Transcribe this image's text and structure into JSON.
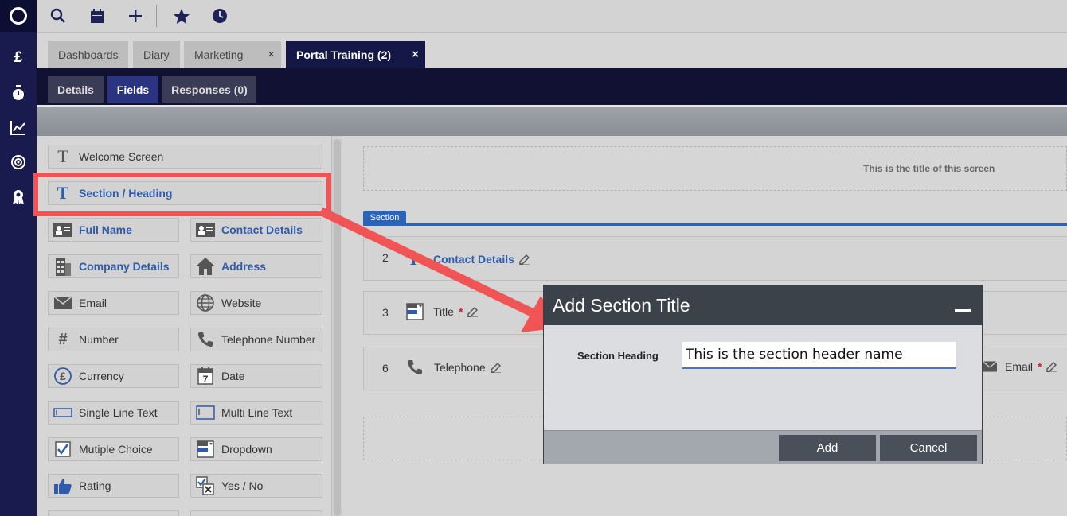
{
  "tabs": [
    {
      "label": "Dashboards"
    },
    {
      "label": "Diary"
    },
    {
      "label": "Marketing",
      "close": "×"
    },
    {
      "label": "Portal Training (2)",
      "close": "×"
    }
  ],
  "subtabs": [
    {
      "label": "Details"
    },
    {
      "label": "Fields"
    },
    {
      "label": "Responses (0)"
    }
  ],
  "palette": {
    "welcome": "Welcome Screen",
    "section_heading": "Section / Heading",
    "full_name": "Full Name",
    "contact_details": "Contact Details",
    "company_details": "Company Details",
    "address": "Address",
    "email": "Email",
    "website": "Website",
    "number": "Number",
    "telephone_number": "Telephone Number",
    "currency": "Currency",
    "date": "Date",
    "date_day": "7",
    "single_line_text": "Single Line Text",
    "multi_line_text": "Multi Line Text",
    "multiple_choice": "Mutiple Choice",
    "dropdown": "Dropdown",
    "rating": "Rating",
    "yes_no": "Yes / No"
  },
  "canvas": {
    "screen_title": "This is the title of this screen",
    "section_tag": "Section",
    "rows": [
      {
        "num": "2",
        "label": "Contact Details"
      },
      {
        "num": "3",
        "label": "Title",
        "required": "*"
      },
      {
        "num": "6",
        "label": "Telephone",
        "right_label": "Email",
        "right_required": "*"
      }
    ]
  },
  "modal": {
    "title": "Add Section Title",
    "field_label": "Section Heading",
    "field_value": "This is the section header name",
    "add": "Add",
    "cancel": "Cancel"
  },
  "colors": {
    "rail": "#191b4f",
    "accent_blue": "#2f5bab",
    "highlight_red": "#f05454",
    "modal_header": "#3c4249"
  }
}
